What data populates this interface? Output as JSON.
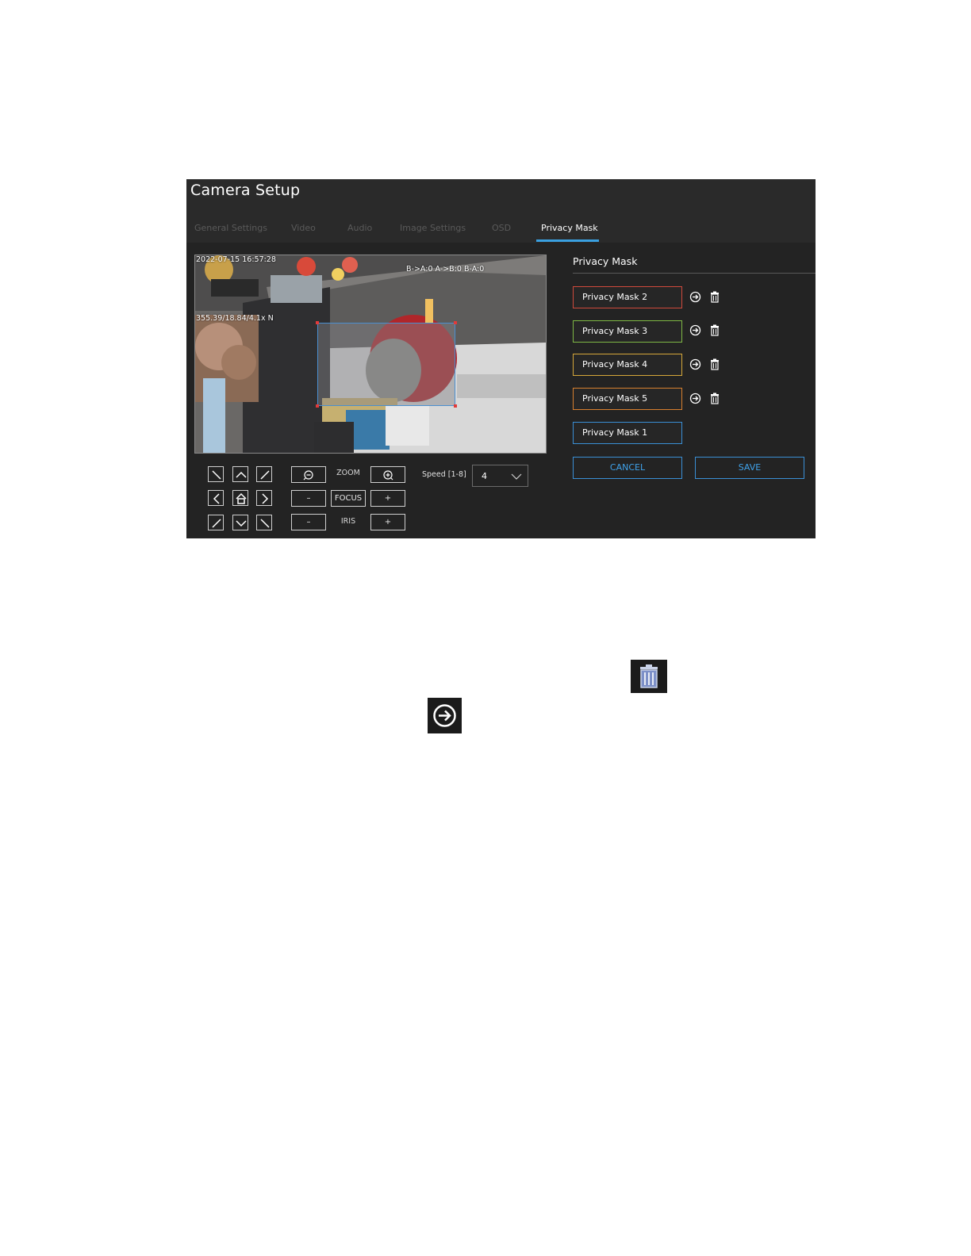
{
  "app": {
    "title": "Camera Setup"
  },
  "tabs": [
    {
      "label": "General Settings",
      "active": false
    },
    {
      "label": "Video",
      "active": false
    },
    {
      "label": "Audio",
      "active": false
    },
    {
      "label": "Image Settings",
      "active": false
    },
    {
      "label": "OSD",
      "active": false
    },
    {
      "label": "Privacy Mask",
      "active": true
    }
  ],
  "video": {
    "timestamp": "2022-07-15 16:57:28",
    "status_text": "B->A:0  A->B:0  B-A:0",
    "ptz_readout": "355.39/18.84/4.1x N"
  },
  "controls": {
    "zoom_label": "ZOOM",
    "focus_label": "FOCUS",
    "iris_label": "IRIS",
    "minus": "–",
    "plus": "+",
    "speed_label": "Speed [1-8]",
    "speed_value": "4"
  },
  "privacy_panel": {
    "title": "Privacy Mask",
    "masks": [
      {
        "label": "Privacy Mask 2",
        "color": "#d04a3c"
      },
      {
        "label": "Privacy Mask 3",
        "color": "#7fb845"
      },
      {
        "label": "Privacy Mask 4",
        "color": "#d6a83a"
      },
      {
        "label": "Privacy Mask 5",
        "color": "#d8802f"
      },
      {
        "label": "Privacy Mask 1",
        "color": "#3a8fd6"
      }
    ],
    "cancel_label": "CANCEL",
    "save_label": "SAVE"
  },
  "icons": {
    "row_icons": [
      "arrow-circle-icon",
      "trash-icon"
    ],
    "legend_icons": [
      "trash-icon",
      "arrow-circle-icon"
    ]
  },
  "colors": {
    "accent": "#3aa0e0",
    "background": "#232323",
    "header": "#2a2a2a"
  }
}
